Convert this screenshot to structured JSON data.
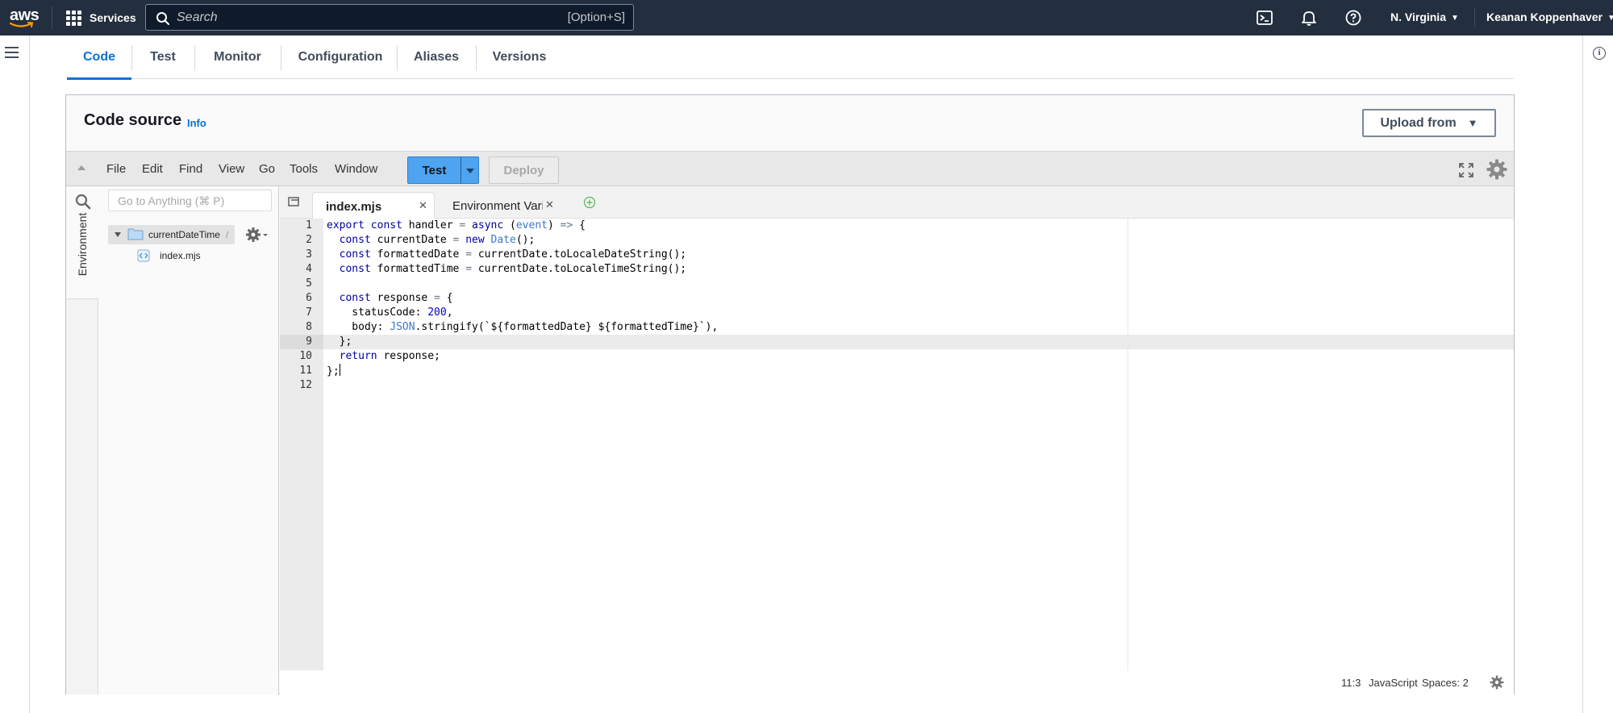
{
  "nav": {
    "logo_text": "aws",
    "services_label": "Services",
    "search_placeholder": "Search",
    "search_shortcut": "[Option+S]",
    "icons": [
      "cloudshell-icon",
      "notifications-icon",
      "help-icon"
    ],
    "region": "N. Virginia",
    "user": "Keanan Koppenhaver"
  },
  "tabs": [
    {
      "label": "Code",
      "active": true
    },
    {
      "label": "Test",
      "active": false
    },
    {
      "label": "Monitor",
      "active": false
    },
    {
      "label": "Configuration",
      "active": false
    },
    {
      "label": "Aliases",
      "active": false
    },
    {
      "label": "Versions",
      "active": false
    }
  ],
  "code_source": {
    "title": "Code source",
    "info_link": "Info",
    "upload_button": "Upload from"
  },
  "ide": {
    "menu": [
      "File",
      "Edit",
      "Find",
      "View",
      "Go",
      "Tools",
      "Window"
    ],
    "test_button": "Test",
    "deploy_button": "Deploy",
    "environment_label": "Environment",
    "goto_placeholder": "Go to Anything (⌘ P)",
    "tree": {
      "folder": "currentDateTime",
      "folder_suffix": "/",
      "files": [
        "index.mjs"
      ]
    },
    "editor_tabs": [
      {
        "label": "index.mjs",
        "active": true
      },
      {
        "label": "Environment Vari",
        "active": false
      }
    ],
    "code_lines": [
      "export const handler = async (event) => {",
      "  const currentDate = new Date();",
      "  const formattedDate = currentDate.toLocaleDateString();",
      "  const formattedTime = currentDate.toLocaleTimeString();",
      "",
      "  const response = {",
      "    statusCode: 200,",
      "    body: JSON.stringify(`${formattedDate} ${formattedTime}`),",
      "  };",
      "  return response;",
      "};",
      ""
    ],
    "cursor_line": 11,
    "status": {
      "position": "11:3",
      "language": "JavaScript",
      "indent": "Spaces: 2"
    }
  },
  "colors": {
    "nav_bg": "#232f3e",
    "accent": "#0972d3",
    "test_button": "#4ea4f0"
  }
}
